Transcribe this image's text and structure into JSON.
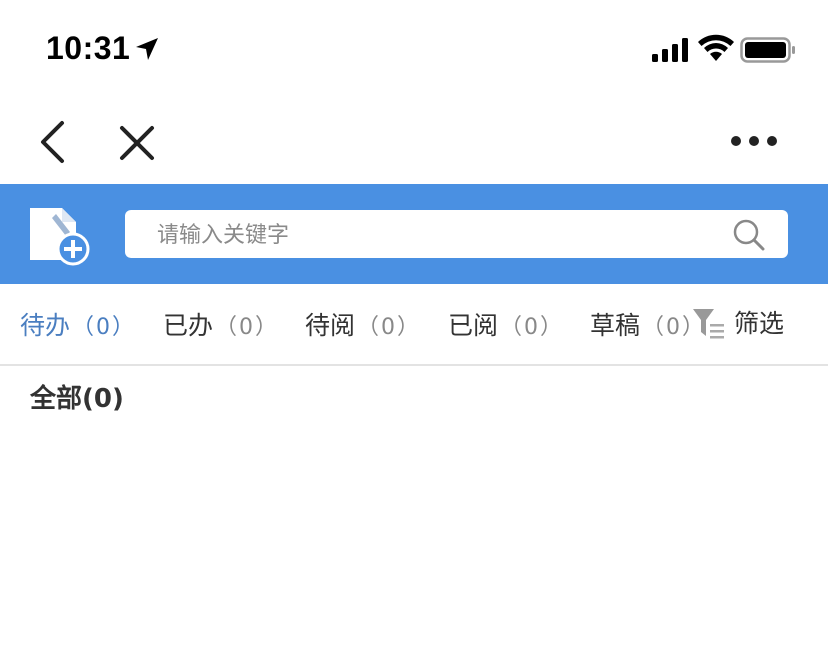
{
  "status_bar": {
    "time": "10:31"
  },
  "search": {
    "placeholder": "请输入关键字",
    "value": ""
  },
  "tabs": [
    {
      "label": "待办",
      "count": "（0）",
      "active": true
    },
    {
      "label": "已办",
      "count": "（0）",
      "active": false
    },
    {
      "label": "待阅",
      "count": "（0）",
      "active": false
    },
    {
      "label": "已阅",
      "count": "（0）",
      "active": false
    },
    {
      "label": "草稿",
      "count": "（0）",
      "active": false
    }
  ],
  "filter": {
    "label": "筛选"
  },
  "content": {
    "section_title": "全部(0)"
  },
  "colors": {
    "accent": "#4a90e2",
    "active_tab": "#4a7ec0"
  },
  "icons": [
    "location-arrow-icon",
    "signal-icon",
    "wifi-icon",
    "battery-icon",
    "back-icon",
    "close-icon",
    "more-icon",
    "new-document-icon",
    "search-icon",
    "filter-icon"
  ]
}
